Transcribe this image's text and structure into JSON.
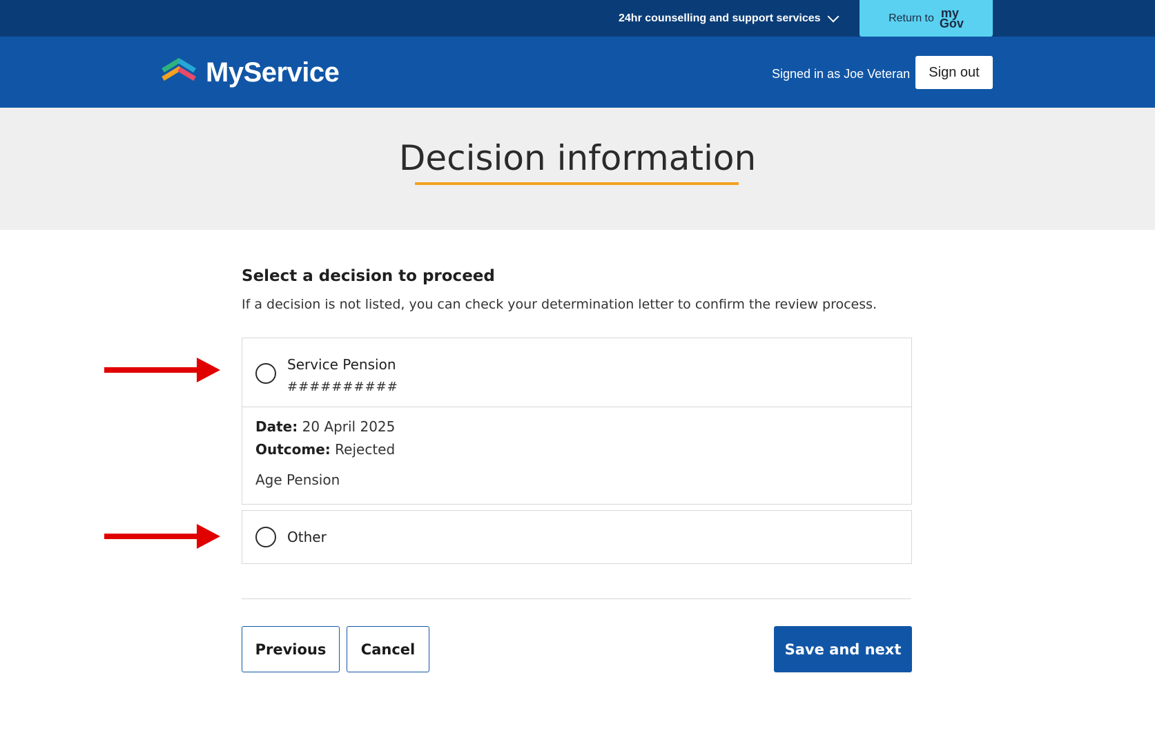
{
  "topbar": {
    "support_label": "24hr counselling and support services",
    "mygov_return": "Return to",
    "mygov_logo_line1": "my",
    "mygov_logo_line2": "Gov",
    "color": "#0a3d77",
    "mygov_color": "#5ad1f0"
  },
  "header": {
    "brand_name": "MyService",
    "signed_in_text": "Signed in as Joe Veteran",
    "signout_label": "Sign out",
    "color": "#1156a6"
  },
  "banner": {
    "title": "Decision information",
    "accent_color": "#f4a11f"
  },
  "main": {
    "heading": "Select a decision to proceed",
    "help_text": "If a decision is not listed, you can check your determination letter to confirm the review process.",
    "options": [
      {
        "title": "Service Pension",
        "id": "##########",
        "date_label": "Date:",
        "date_value": "20 April 2025",
        "outcome_label": "Outcome:",
        "outcome_value": "Rejected",
        "category": "Age Pension",
        "selected": false
      },
      {
        "title": "Other",
        "selected": false
      }
    ]
  },
  "actions": {
    "previous_label": "Previous",
    "cancel_label": "Cancel",
    "save_label": "Save and next"
  },
  "annotations": {
    "arrow_color": "#e00000"
  }
}
